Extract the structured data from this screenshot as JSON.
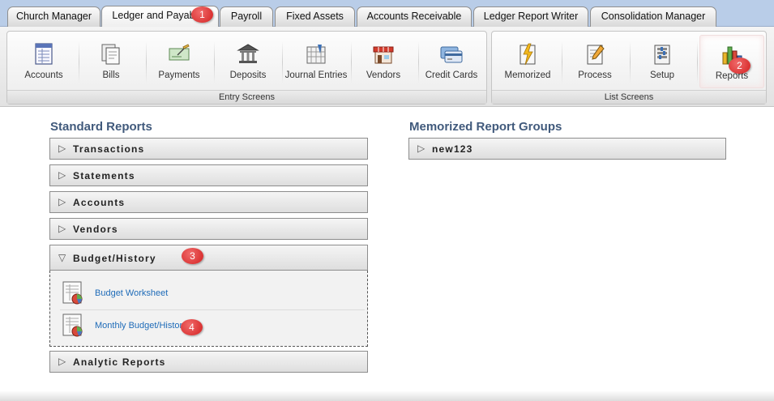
{
  "tabs": [
    {
      "label": "Church Manager"
    },
    {
      "label": "Ledger and Payables"
    },
    {
      "label": "Payroll"
    },
    {
      "label": "Fixed Assets"
    },
    {
      "label": "Accounts Receivable"
    },
    {
      "label": "Ledger Report Writer"
    },
    {
      "label": "Consolidation Manager"
    }
  ],
  "ribbon": {
    "entry_group_label": "Entry Screens",
    "list_group_label": "List Screens",
    "entry_buttons": [
      {
        "label": "Accounts",
        "icon": "accounts-ledger-icon"
      },
      {
        "label": "Bills",
        "icon": "bills-icon"
      },
      {
        "label": "Payments",
        "icon": "payments-check-icon"
      },
      {
        "label": "Deposits",
        "icon": "bank-icon"
      },
      {
        "label": "Journal Entries",
        "icon": "journal-icon"
      },
      {
        "label": "Vendors",
        "icon": "store-icon"
      },
      {
        "label": "Credit Cards",
        "icon": "credit-card-icon"
      }
    ],
    "list_buttons": [
      {
        "label": "Memorized",
        "icon": "memorized-icon"
      },
      {
        "label": "Process",
        "icon": "process-icon"
      },
      {
        "label": "Setup",
        "icon": "setup-icon"
      },
      {
        "label": "Reports",
        "icon": "bar-chart-icon"
      }
    ]
  },
  "standard_reports": {
    "title": "Standard Reports",
    "panels": [
      {
        "label": "Transactions"
      },
      {
        "label": "Statements"
      },
      {
        "label": "Accounts"
      },
      {
        "label": "Vendors"
      },
      {
        "label": "Budget/History"
      },
      {
        "label": "Analytic Reports"
      }
    ],
    "budget_items": [
      {
        "label": "Budget Worksheet"
      },
      {
        "label": "Monthly Budget/History"
      }
    ]
  },
  "memorized_groups": {
    "title": "Memorized Report Groups",
    "panels": [
      {
        "label": "new123"
      }
    ]
  },
  "callouts": [
    "1",
    "2",
    "3",
    "4"
  ],
  "colors": {
    "accent_title": "#415a7c",
    "link": "#1e6bb8",
    "callout": "#d32020",
    "tabbar": "#b9cde8"
  }
}
